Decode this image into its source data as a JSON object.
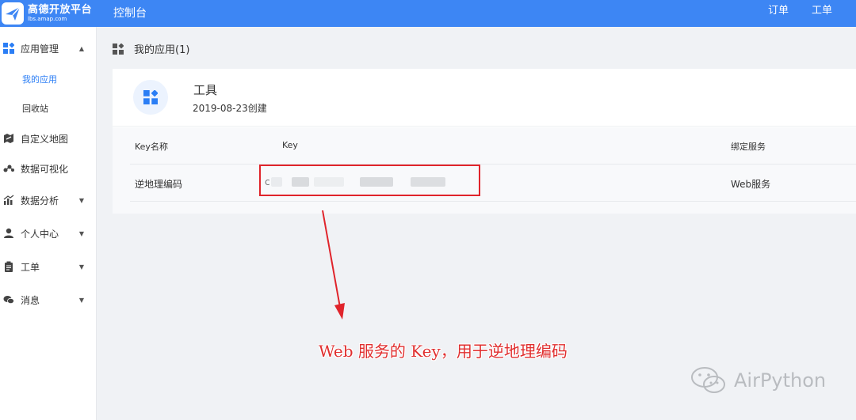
{
  "topbar": {
    "logo_cn": "高德开放平台",
    "logo_en": "lbs.amap.com",
    "console_title": "控制台",
    "links": [
      "订单",
      "工单"
    ]
  },
  "sidebar": {
    "items": [
      {
        "label": "应用管理",
        "icon": "app-grid-icon",
        "caret": "up"
      },
      {
        "label": "我的应用",
        "sub": true,
        "active": true
      },
      {
        "label": "回收站",
        "sub": true
      },
      {
        "label": "自定义地图",
        "icon": "map-icon"
      },
      {
        "label": "数据可视化",
        "icon": "visualization-icon"
      },
      {
        "label": "数据分析",
        "icon": "chart-icon",
        "caret": "down"
      },
      {
        "label": "个人中心",
        "icon": "user-icon",
        "caret": "down"
      },
      {
        "label": "工单",
        "icon": "clipboard-icon",
        "caret": "down"
      },
      {
        "label": "消息",
        "icon": "message-icon",
        "caret": "down"
      }
    ]
  },
  "main": {
    "page_title": "我的应用(1)",
    "app": {
      "name": "工具",
      "created": "2019-08-23创建"
    },
    "table": {
      "headers": [
        "Key名称",
        "Key",
        "绑定服务"
      ],
      "rows": [
        {
          "name": "逆地理编码",
          "key_prefix": "c",
          "service": "Web服务"
        }
      ]
    }
  },
  "annotation": {
    "text": "Web 服务的 Key，用于逆地理编码",
    "color": "#e02f2f"
  },
  "watermark": {
    "text": "AirPython"
  },
  "colors": {
    "brand": "#3d86f4",
    "accent": "#2b7ef5",
    "highlight": "#e0242b"
  }
}
